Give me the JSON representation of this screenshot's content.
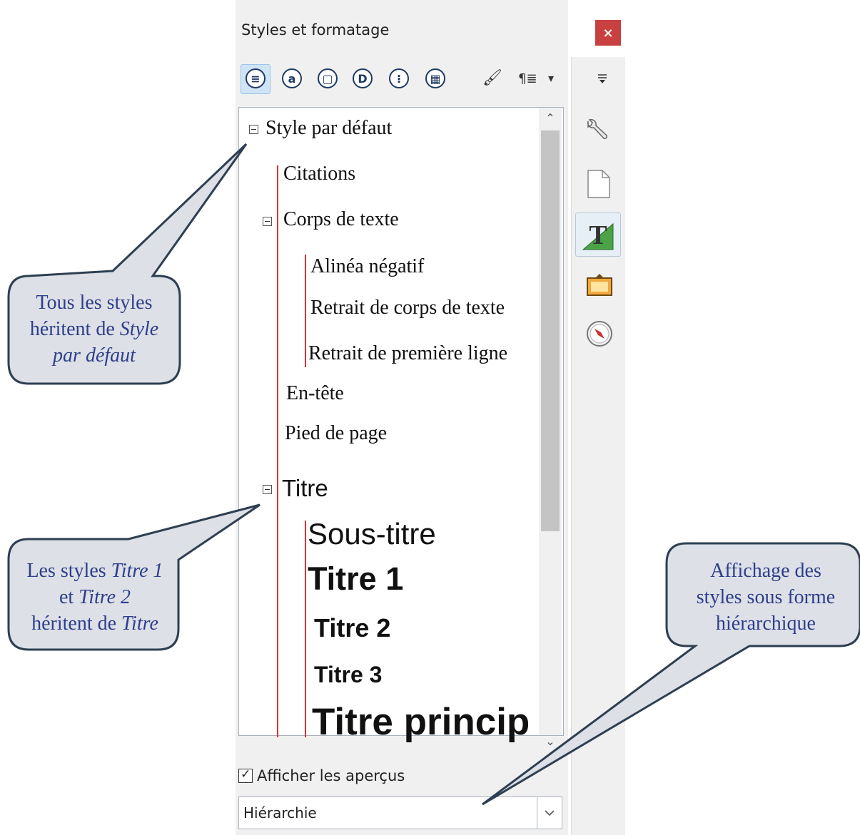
{
  "panel": {
    "title": "Styles et formatage",
    "close_label": "×"
  },
  "toolbar": {
    "buttons": [
      {
        "icon": "paragraph-styles-icon",
        "glyph": "≡"
      },
      {
        "icon": "character-styles-icon",
        "glyph": "a"
      },
      {
        "icon": "frame-styles-icon",
        "glyph": "▢"
      },
      {
        "icon": "page-styles-icon",
        "glyph": "D"
      },
      {
        "icon": "list-styles-icon",
        "glyph": "⁝"
      },
      {
        "icon": "table-styles-icon",
        "glyph": "▦"
      }
    ],
    "fill_format_glyph": "🖌",
    "new_style_glyph": "¶≣",
    "dropdown_glyph": "▾"
  },
  "styles": {
    "items": [
      {
        "label": "Style par défaut"
      },
      {
        "label": "Citations"
      },
      {
        "label": "Corps de texte"
      },
      {
        "label": "Alinéa négatif"
      },
      {
        "label": "Retrait de corps de texte"
      },
      {
        "label": "Retrait de première ligne"
      },
      {
        "label": "En-tête"
      },
      {
        "label": "Pied de page"
      },
      {
        "label": "Titre"
      },
      {
        "label": "Sous-titre"
      },
      {
        "label": "Titre 1"
      },
      {
        "label": "Titre 2"
      },
      {
        "label": "Titre 3"
      },
      {
        "label": "Titre princip"
      }
    ]
  },
  "footer": {
    "show_previews_label": "Afficher les aperçus",
    "show_previews_checked": true,
    "view_mode": "Hiérarchie"
  },
  "callouts": {
    "c1": {
      "line1": "Tous les styles",
      "line2a": "héritent de ",
      "line2b": "Style",
      "line3": "par défaut"
    },
    "c2": {
      "line1a": "Les styles ",
      "line1b": "Titre 1",
      "line2a": "et ",
      "line2b": "Titre 2",
      "line3a": "héritent de ",
      "line3b": "Titre"
    },
    "c3": {
      "line1": "Affichage des",
      "line2": "styles sous forme",
      "line3": "hiérarchique"
    }
  },
  "colors": {
    "callout_fill": "#dde0e6",
    "callout_stroke": "#2e3f52",
    "callout_text": "#2d3e8c",
    "tree_line": "#e03030",
    "close_button": "#c94040"
  }
}
